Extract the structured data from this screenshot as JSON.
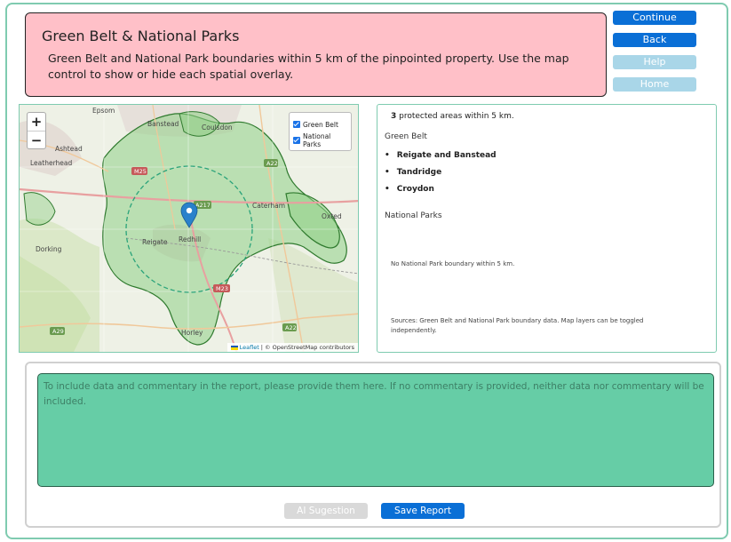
{
  "header": {
    "title": "Green Belt & National Parks",
    "description": "Green Belt and National Park boundaries within 5 km of the pinpointed property. Use the map control to show or hide each spatial overlay."
  },
  "nav": {
    "continue_label": "Continue",
    "back_label": "Back",
    "help_label": "Help",
    "home_label": "Home"
  },
  "map": {
    "zoom_in": "+",
    "zoom_out": "−",
    "layers": [
      {
        "label": "Green Belt",
        "checked": true
      },
      {
        "label": "National Parks",
        "checked": true
      }
    ],
    "place_labels": {
      "epsom": "Epsom",
      "banstead": "Banstead",
      "coulsdon": "Coulsdon",
      "ashtead": "Ashtead",
      "leatherhead": "Leatherhead",
      "caterham": "Caterham",
      "oxted": "Oxted",
      "dorking": "Dorking",
      "reigate": "Reigate",
      "redhill": "Redhill",
      "horley": "Horley"
    },
    "road_labels": {
      "m25": "M25",
      "a22": "A22",
      "a217": "A217",
      "m23": "M23",
      "a29": "A29",
      "a22b": "A22"
    },
    "attribution_leaflet": "Leaflet",
    "attribution_rest": "| © OpenStreetMap contributors",
    "colors": {
      "green_belt_fill": "#8fcf86",
      "green_belt_stroke": "#2f7a2e",
      "buffer_stroke": "#2aa37a",
      "marker": "#2a81cb"
    }
  },
  "info": {
    "count": "3",
    "summary_suffix": " protected areas within 5 km.",
    "green_belt_heading": "Green Belt",
    "green_belt_areas": [
      "Reigate and Banstead",
      "Tandridge",
      "Croydon"
    ],
    "national_parks_heading": "National Parks",
    "national_parks_empty": "No National Park boundary within 5 km.",
    "sources": "Sources: Green Belt and National Park boundary data. Map layers can be toggled independently."
  },
  "commentary": {
    "placeholder": "To include data and commentary in the report, please provide them here. If no commentary is provided, neither data nor commentary will be included.",
    "ai_label": "AI Sugestion",
    "save_label": "Save Report"
  }
}
